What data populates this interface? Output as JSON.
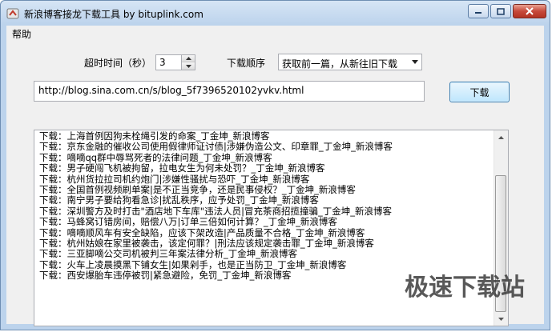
{
  "window": {
    "title": "新浪博客接龙下载工具 by bituplink.com"
  },
  "menu": {
    "help": "帮助"
  },
  "controls": {
    "timeout_label": "超时时间（秒）",
    "timeout_value": "3",
    "order_label": "下载顺序",
    "order_value": "获取前一篇，从新往旧下载"
  },
  "url": {
    "value": "http://blog.sina.com.cn/s/blog_5f7396520102yvkv.html"
  },
  "download_button": "下载",
  "log": [
    "下载：上海首例因狗未栓绳引发的命案_丁金坤_新浪博客",
    "下载：京东金融的催收公司使用假律师证讨债|涉嫌伪造公文、印章罪_丁金坤_新浪博客",
    "下载：嘀嘀qq群中辱骂死者的法律问题_丁金坤_新浪博客",
    "下载：男子硬闯飞机被拘留，拉电女生为何未处罚？_丁金坤_新浪博客",
    "下载：杭州货拉拉司机约炮门|涉嫌性骚扰与恐吓_丁金坤_新浪博客",
    "下载：全国首例视频刷单案|是不正当竞争，还是民事侵权？_丁金坤_新浪博客",
    "下载：南宁男子要给狗看急诊|扰乱秩序，应予处罚_丁金坤_新浪博客",
    "下载：深圳警方及时打击\"酒店地下车库\"违法人员|冒充茶商招揽撞骗_丁金坤_新浪博客",
    "下载：马蜂窝订错房间，赔偿八万|订单三倍如何计算？_丁金坤_新浪博客",
    "下载：嘀嘀顺风车有安全缺陷，应该下架改造|产品质量不合格_丁金坤_新浪博客",
    "下载：杭州姑娘在家里被袭击，该定何罪？|刑法应该规定袭击罪_丁金坤_新浪博客",
    "下载：三亚脚嘀公交司机被判三年案法律分析_丁金坤_新浪博客",
    "下载：火车上凌晨摸黑下铺女生|如果剁手，也是正当防卫_丁金坤_新浪博客",
    "下载：西安爆胎车违停被罚|紧急避险，免罚_丁金坤_新浪博客"
  ],
  "watermark": "极速下载站",
  "colors": {
    "titlebar": "#bcd3ec",
    "close_button": "#c7493a",
    "button_face": "#bee6fd",
    "client": "#f0f0f0"
  }
}
